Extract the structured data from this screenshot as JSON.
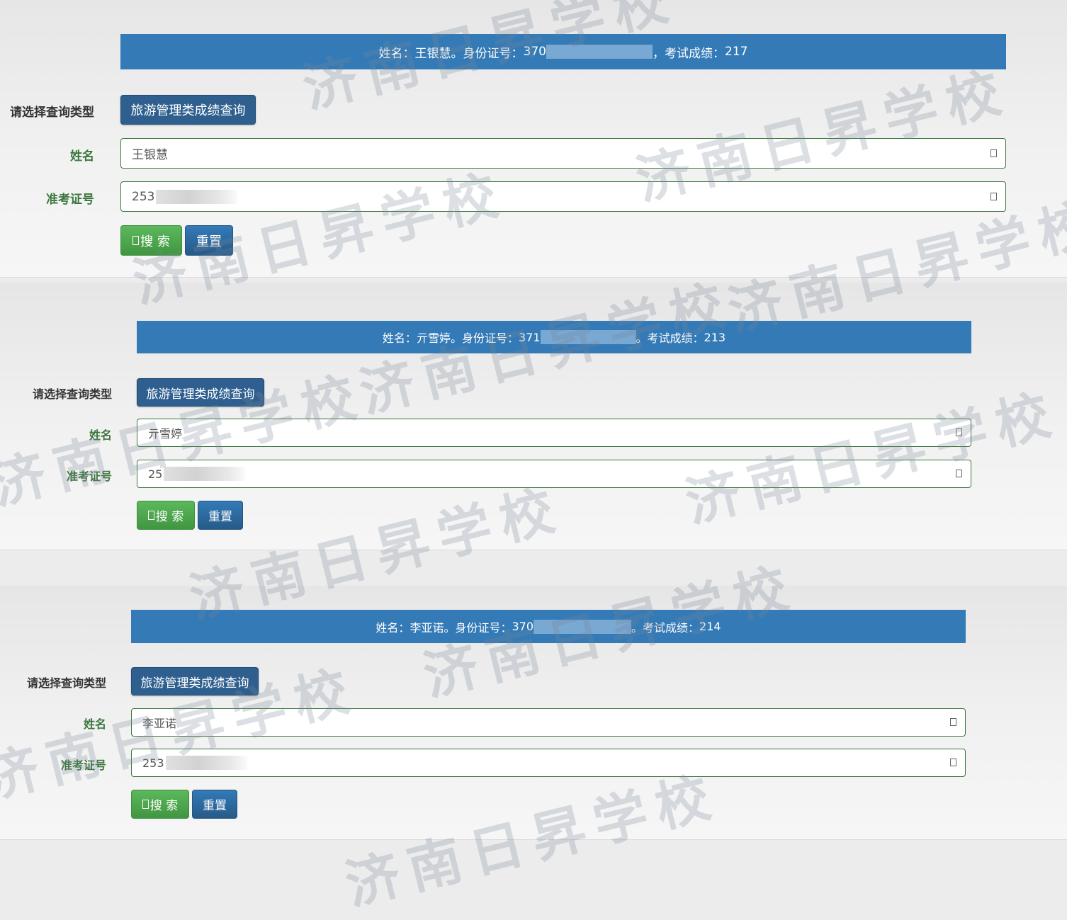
{
  "panels": [
    {
      "banner": {
        "name_label": "姓名：",
        "name": "王银慧",
        "id_label": "。身份证号：",
        "id_prefix": "370",
        "score_label": "，考试成绩：",
        "score": "217"
      },
      "type_label": "请选择查询类型",
      "type_button": "旅游管理类成绩查询",
      "name_field_label": "姓名",
      "name_value": "王银慧",
      "exam_label": "准考证号",
      "exam_value": "253",
      "search_button": "搜 索",
      "reset_button": "重置"
    },
    {
      "banner": {
        "name_label": "姓名：",
        "name": "亓雪婷",
        "id_label": "。身份证号：",
        "id_prefix": "371",
        "score_label": "。考试成绩：",
        "score": "213"
      },
      "type_label": "请选择查询类型",
      "type_button": "旅游管理类成绩查询",
      "name_field_label": "姓名",
      "name_value": "亓雪婷",
      "exam_label": "准考证号",
      "exam_value": "25",
      "search_button": "搜 索",
      "reset_button": "重置"
    },
    {
      "banner": {
        "name_label": "姓名：",
        "name": "李亚诺",
        "id_label": "。身份证号：",
        "id_prefix": "370",
        "score_label": "。考试成绩：",
        "score": "214"
      },
      "type_label": "请选择查询类型",
      "type_button": "旅游管理类成绩查询",
      "name_field_label": "姓名",
      "name_value": "李亚诺",
      "exam_label": "准考证号",
      "exam_value": "253",
      "search_button": "搜 索",
      "reset_button": "重置"
    }
  ],
  "watermark": "济南日昇学校",
  "colors": {
    "banner": "#337ab7",
    "type_button": "#2e5f8f",
    "label_green": "#3c763d",
    "search_green": "#5cb85c",
    "reset_blue": "#265a88"
  }
}
